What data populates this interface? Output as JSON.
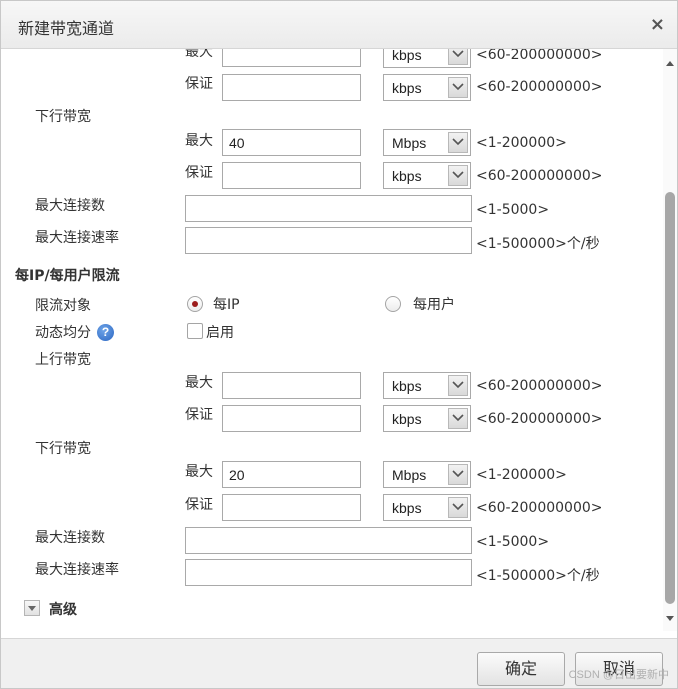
{
  "dialog": {
    "title": "新建带宽通道",
    "close_symbol": "×"
  },
  "units": {
    "max": "最大",
    "guarantee": "保证"
  },
  "top_partial": {
    "max_unit": "kbps",
    "max_hint": "<60-200000000>",
    "guarantee_unit": "kbps",
    "guarantee_hint": "<60-200000000>"
  },
  "downlink1": {
    "label": "下行带宽",
    "max_value": "40",
    "max_unit": "Mbps",
    "max_hint": "<1-200000>",
    "guarantee_value": "",
    "guarantee_unit": "kbps",
    "guarantee_hint": "<60-200000000>"
  },
  "conn1": {
    "max_conn_label": "最大连接数",
    "max_conn_hint": "<1-5000>",
    "rate_label": "最大连接速率",
    "rate_hint": "<1-500000>个/秒"
  },
  "per_ip": {
    "section_title": "每IP/每用户限流",
    "target_label": "限流对象",
    "option_ip": "每IP",
    "option_user": "每用户",
    "selected": "每IP",
    "dynamic_label": "动态均分",
    "enable_label": "启用",
    "uplink_label": "上行带宽",
    "up_max_value": "",
    "up_max_unit": "kbps",
    "up_max_hint": "<60-200000000>",
    "up_guar_value": "",
    "up_guar_unit": "kbps",
    "up_guar_hint": "<60-200000000>",
    "downlink_label": "下行带宽",
    "down_max_value": "20",
    "down_max_unit": "Mbps",
    "down_max_hint": "<1-200000>",
    "down_guar_value": "",
    "down_guar_unit": "kbps",
    "down_guar_hint": "<60-200000000>"
  },
  "conn2": {
    "max_conn_label": "最大连接数",
    "max_conn_hint": "<1-5000>",
    "rate_label": "最大连接速率",
    "rate_hint": "<1-500000>个/秒"
  },
  "advanced": {
    "label": "高级"
  },
  "footer": {
    "ok_label": "确定",
    "cancel_label": "取消",
    "watermark": "CSDN @日出要新中"
  },
  "colors": {
    "radio_selected": "#9b1b1b",
    "help_icon": "#2b66c2",
    "scroll_thumb": "#a7a7a7"
  }
}
